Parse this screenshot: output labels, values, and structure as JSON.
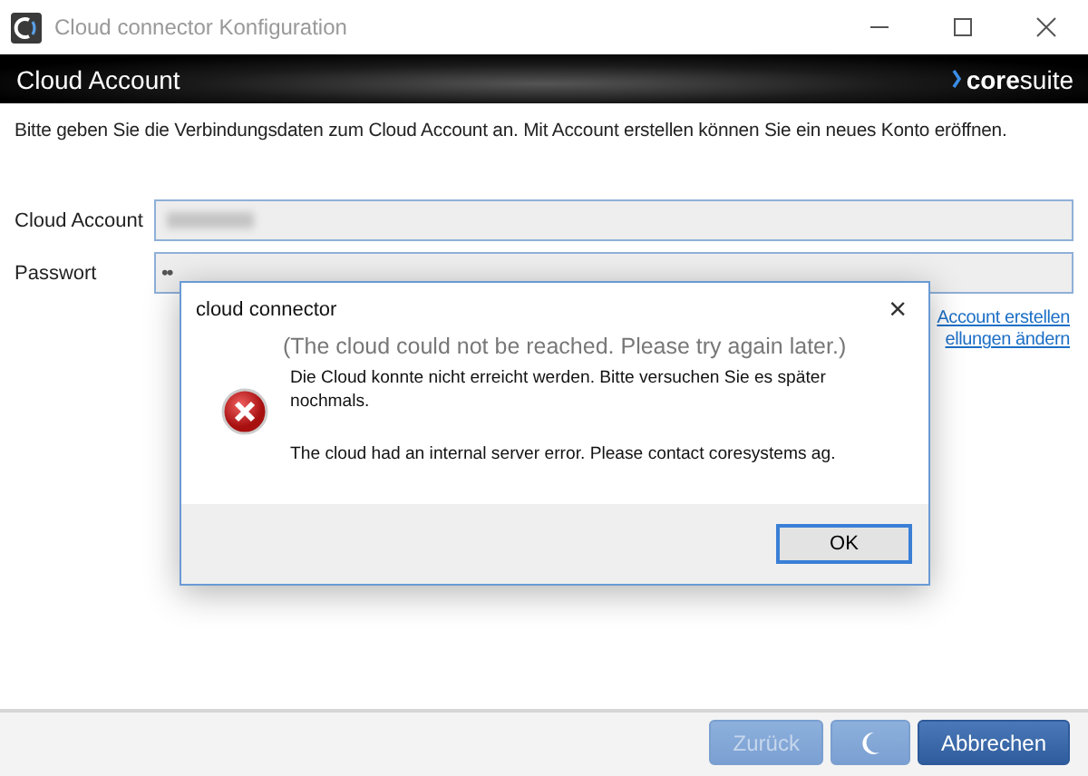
{
  "window": {
    "title": "Cloud connector Konfiguration"
  },
  "header": {
    "title": "Cloud Account",
    "logo": "**core**suite"
  },
  "intro": "Bitte geben Sie die Verbindungsdaten zum Cloud Account an. Mit Account erstellen können Sie ein neues Konto eröffnen.",
  "fields": [
    {
      "label": "Cloud Account",
      "kind": "text"
    },
    {
      "label": "Passwort",
      "kind": "password",
      "value": "••"
    }
  ],
  "links": [
    "Account erstellen",
    "ellungen ändern"
  ],
  "buttons": [
    {
      "kind": "text",
      "label": "Zurück",
      "disabled": true
    },
    {
      "kind": "spinner",
      "disabled": true
    },
    {
      "kind": "text",
      "label": "Abbrechen",
      "disabled": false
    }
  ],
  "dialog": {
    "title": "cloud connector",
    "close": "×",
    "main_instruction": "(The cloud could not be reached. Please try again later.)",
    "messages": [
      "Die Cloud konnte nicht erreicht werden. Bitte versuchen Sie es später nochmals.",
      "The cloud had an internal server error. Please contact coresystems ag."
    ],
    "buttons": [
      {
        "label": "OK",
        "default": true
      }
    ]
  }
}
